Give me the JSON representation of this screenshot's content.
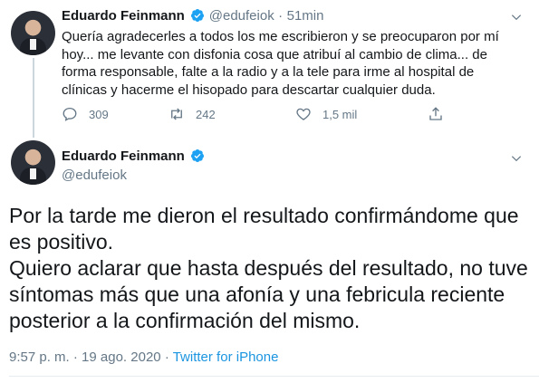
{
  "tweet1": {
    "author_name": "Eduardo Feinmann",
    "handle": "@edufeiok",
    "separator": "·",
    "time": "51min",
    "text": "Quería agradecerles a todos los me escribieron y se preocuparon por mí hoy... me levante con disfonia cosa que atribuí al cambio de clima... de forma responsable, falte a la radio y a la tele para irme al hospital de clínicas y hacerme el hisopado para descartar cualquier duda.",
    "replies": "309",
    "retweets": "242",
    "likes": "1,5 mil"
  },
  "tweet2": {
    "author_name": "Eduardo Feinmann",
    "handle": "@edufeiok",
    "text_lines": [
      "Por la tarde me dieron el resultado confirmándome que es positivo.",
      "Quiero aclarar que hasta después del resultado, no tuve síntomas más que una afonía y una febricula reciente posterior a la confirmación del mismo."
    ],
    "time": "9:57 p. m.",
    "separator": "·",
    "date": "19 ago. 2020",
    "source": "Twitter for iPhone"
  },
  "icons": {
    "verified": "verified-badge-icon",
    "reply": "reply-icon",
    "retweet": "retweet-icon",
    "like": "heart-icon",
    "share": "share-icon",
    "more": "chevron-down-icon"
  },
  "colors": {
    "verified_blue": "#1da1f2",
    "muted": "#657786",
    "link": "#1b95e0",
    "text": "#14171a"
  }
}
